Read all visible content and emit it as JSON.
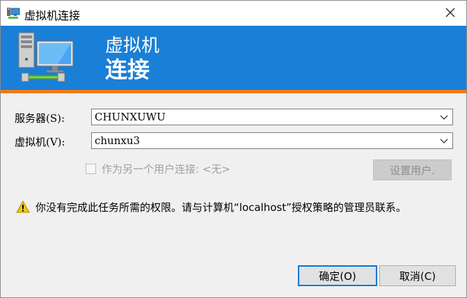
{
  "window": {
    "title": "虚拟机连接"
  },
  "banner": {
    "line1": "虚拟机",
    "line2": "连接",
    "background_color": "#1a7fd6",
    "accent_color": "#ee7a1a"
  },
  "form": {
    "server_label": "服务器(S):",
    "server_value": "CHUNXUWU",
    "vm_label": "虚拟机(V):",
    "vm_value": "chunxu3",
    "connect_as_label": "作为另一个用户连接: <无>",
    "connect_as_checked": false,
    "set_user_label": "设置用户."
  },
  "warning": {
    "icon": "warning-icon",
    "text": "你没有完成此任务所需的权限。请与计算机“localhost”授权策略的管理员联系。"
  },
  "buttons": {
    "ok_label": "确定(O)",
    "cancel_label": "取消(C)"
  }
}
